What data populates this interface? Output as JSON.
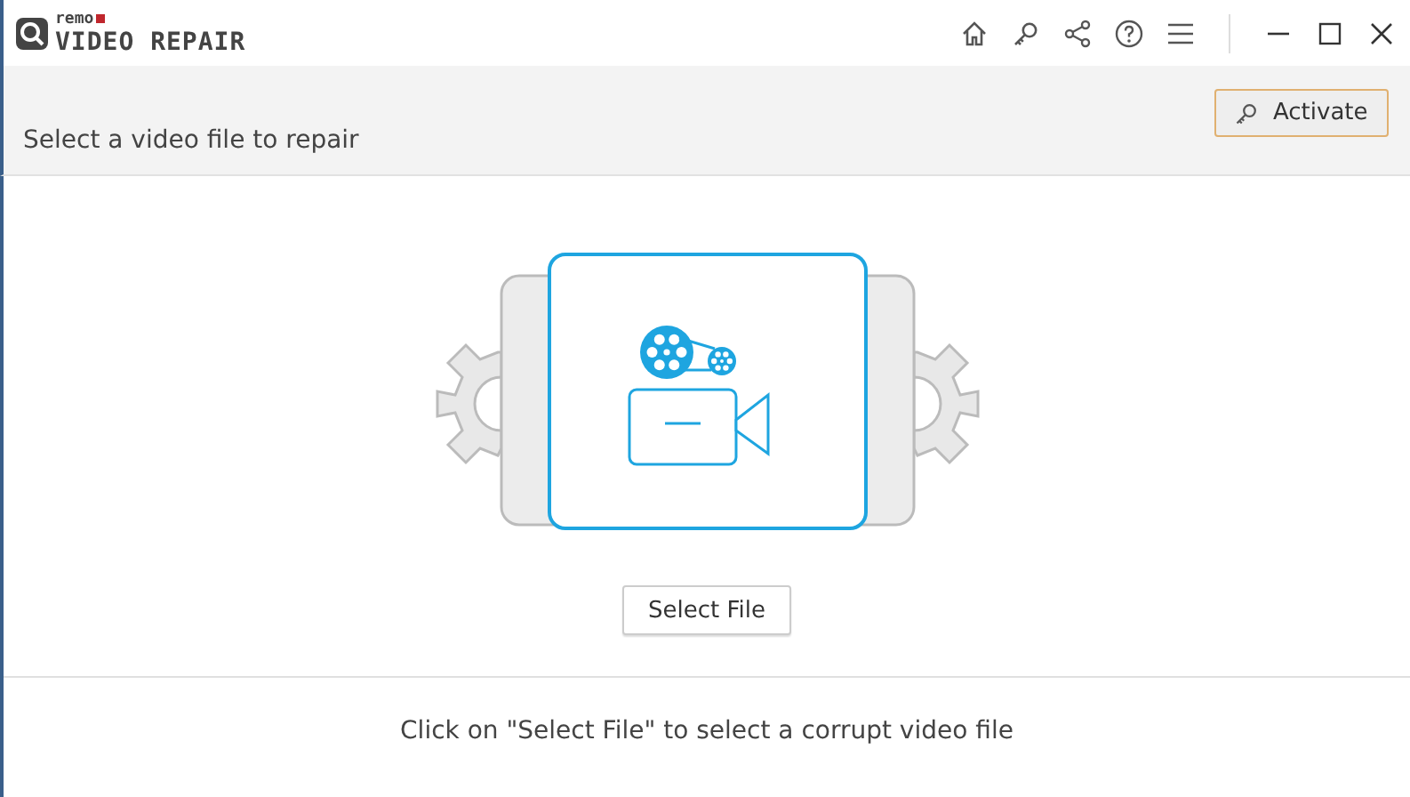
{
  "logo": {
    "brand": "remo",
    "product": "VIDEO REPAIR"
  },
  "toolbar": [
    {
      "kind": "home"
    },
    {
      "kind": "key"
    },
    {
      "kind": "share"
    },
    {
      "kind": "help"
    },
    {
      "kind": "menu"
    }
  ],
  "window_controls": [
    {
      "kind": "minimize"
    },
    {
      "kind": "maximize"
    },
    {
      "kind": "close"
    }
  ],
  "header": {
    "instruction": "Select a video file to repair",
    "activate_button": "Activate"
  },
  "select_button": "Select File",
  "hint": "Click on \"Select File\" to select a corrupt video file"
}
